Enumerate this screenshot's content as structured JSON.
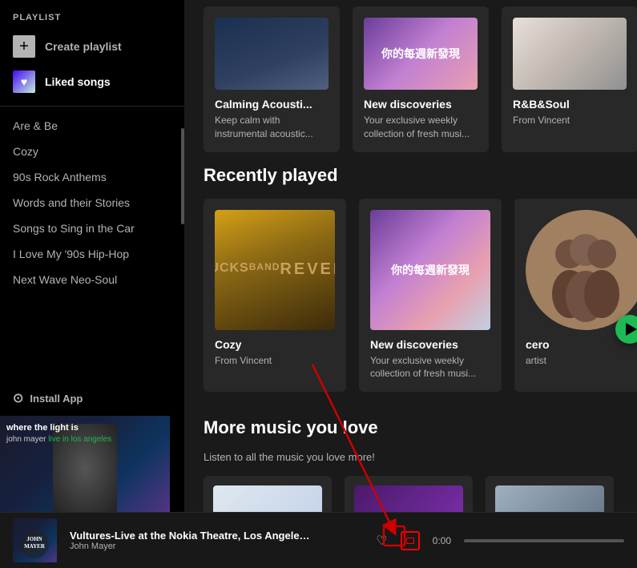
{
  "sidebar": {
    "playlist_label": "PLAYLIST",
    "create_playlist": "Create playlist",
    "liked_songs": "Liked songs",
    "playlists": [
      {
        "name": "Are & Be"
      },
      {
        "name": "Cozy"
      },
      {
        "name": "90s Rock Anthems"
      },
      {
        "name": "Words and their Stories"
      },
      {
        "name": "Songs to Sing in the Car"
      },
      {
        "name": "I Love My '90s Hip-Hop"
      },
      {
        "name": "Next Wave Neo-Soul"
      }
    ],
    "install_app": "Install App"
  },
  "top_cards": [
    {
      "title": "Calming Acousti...",
      "subtitle": "Keep calm with instrumental acoustic...",
      "type": "calming"
    },
    {
      "title": "New discoveries",
      "subtitle": "Your exclusive weekly collection of fresh musi...",
      "type": "new-disc",
      "chinese": "你的每週新發現"
    },
    {
      "title": "R&B&Soul",
      "subtitle": "From Vincent",
      "type": "rnb"
    }
  ],
  "recently_played": {
    "section_title": "Recently played",
    "cards": [
      {
        "title": "Cozy",
        "subtitle": "From Vincent",
        "type": "revelator"
      },
      {
        "title": "New discoveries",
        "subtitle": "Your exclusive weekly collection of fresh musi...",
        "type": "new-disc",
        "chinese": "你的每週新發現"
      },
      {
        "title": "cero",
        "subtitle": "artist",
        "type": "cero",
        "has_play": true
      }
    ]
  },
  "more_music": {
    "section_title": "More music you love",
    "subtitle": "Listen to all the music you love more!",
    "cards": [
      {
        "type": "more1"
      },
      {
        "type": "more2"
      },
      {
        "type": "more3"
      }
    ]
  },
  "player": {
    "track_title": "Vultures-Live at the Nokia Theatre, Los Angeles, CA-Decembe...",
    "artist": "John Mayer",
    "time": "0:00"
  }
}
